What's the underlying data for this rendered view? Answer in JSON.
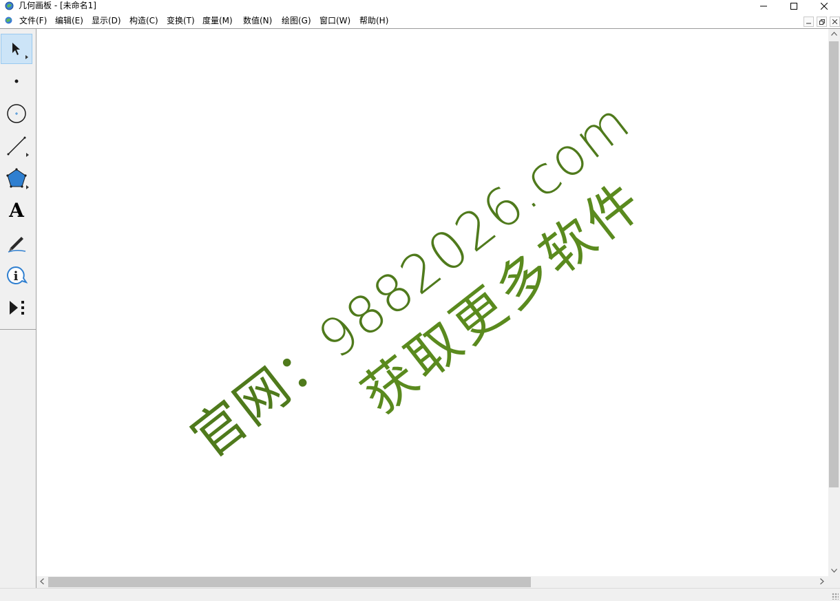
{
  "window": {
    "title": "几何画板 - [未命名1]",
    "minimize_icon": "minimize-icon",
    "maximize_icon": "maximize-icon",
    "close_icon": "close-icon"
  },
  "menu": {
    "items": [
      {
        "label": "文件(F)"
      },
      {
        "label": "编辑(E)"
      },
      {
        "label": "显示(D)"
      },
      {
        "label": "构造(C)"
      },
      {
        "label": "变换(T)"
      },
      {
        "label": "度量(M)"
      },
      {
        "label": "数值(N)"
      },
      {
        "label": "绘图(G)"
      },
      {
        "label": "窗口(W)"
      },
      {
        "label": "帮助(H)"
      }
    ],
    "mdi_controls": [
      "minimize-icon",
      "restore-icon",
      "close-icon"
    ]
  },
  "toolbox": {
    "tools": [
      {
        "name": "arrow-tool",
        "icon": "selection-arrow-icon",
        "active": true
      },
      {
        "name": "point-tool",
        "icon": "point-icon"
      },
      {
        "name": "compass-tool",
        "icon": "circle-icon"
      },
      {
        "name": "straightedge-tool",
        "icon": "segment-icon"
      },
      {
        "name": "polygon-tool",
        "icon": "pentagon-icon"
      },
      {
        "name": "text-tool",
        "icon": "text-a-icon",
        "glyph": "A"
      },
      {
        "name": "marker-tool",
        "icon": "pen-icon"
      },
      {
        "name": "information-tool",
        "icon": "info-icon"
      },
      {
        "name": "custom-tool",
        "icon": "custom-tools-icon"
      }
    ]
  },
  "canvas": {
    "watermark_line1": "官网：9882026.com",
    "watermark_line2": "获取更多软件",
    "watermark_color": "#4f7a1c"
  },
  "scrollbars": {
    "vertical": {
      "thumb_position": 0.0,
      "thumb_fraction": 0.84
    },
    "horizontal": {
      "thumb_position": 0.0,
      "thumb_fraction": 0.63
    }
  }
}
